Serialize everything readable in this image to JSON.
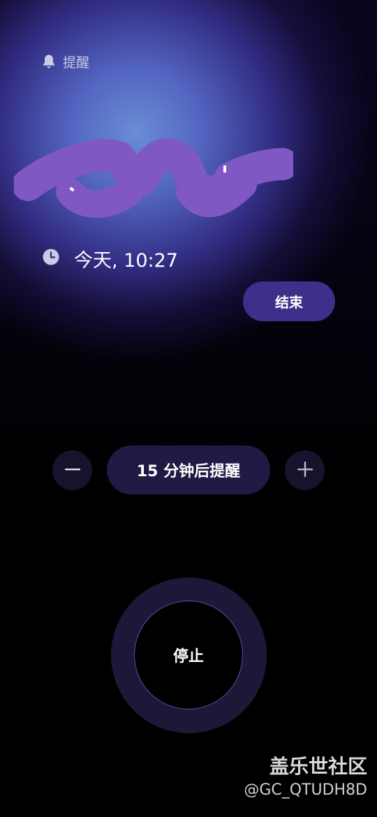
{
  "header": {
    "label": "提醒",
    "icon": "bell-icon"
  },
  "alarm": {
    "title_redacted": true,
    "time": "今天, 10:27",
    "time_icon": "clock-icon"
  },
  "actions": {
    "end_label": "结束",
    "snooze_label": "15 分钟后提醒",
    "decrease_icon": "minus-icon",
    "increase_icon": "plus-icon",
    "stop_label": "停止"
  },
  "watermark": {
    "title": "盖乐世社区",
    "handle": "@GC_QTUDH8D"
  },
  "colors": {
    "accent": "#3d2f8a",
    "redaction": "#7f58c4",
    "snooze_bg": "#201b44",
    "stop_ring": "#1c1838"
  }
}
